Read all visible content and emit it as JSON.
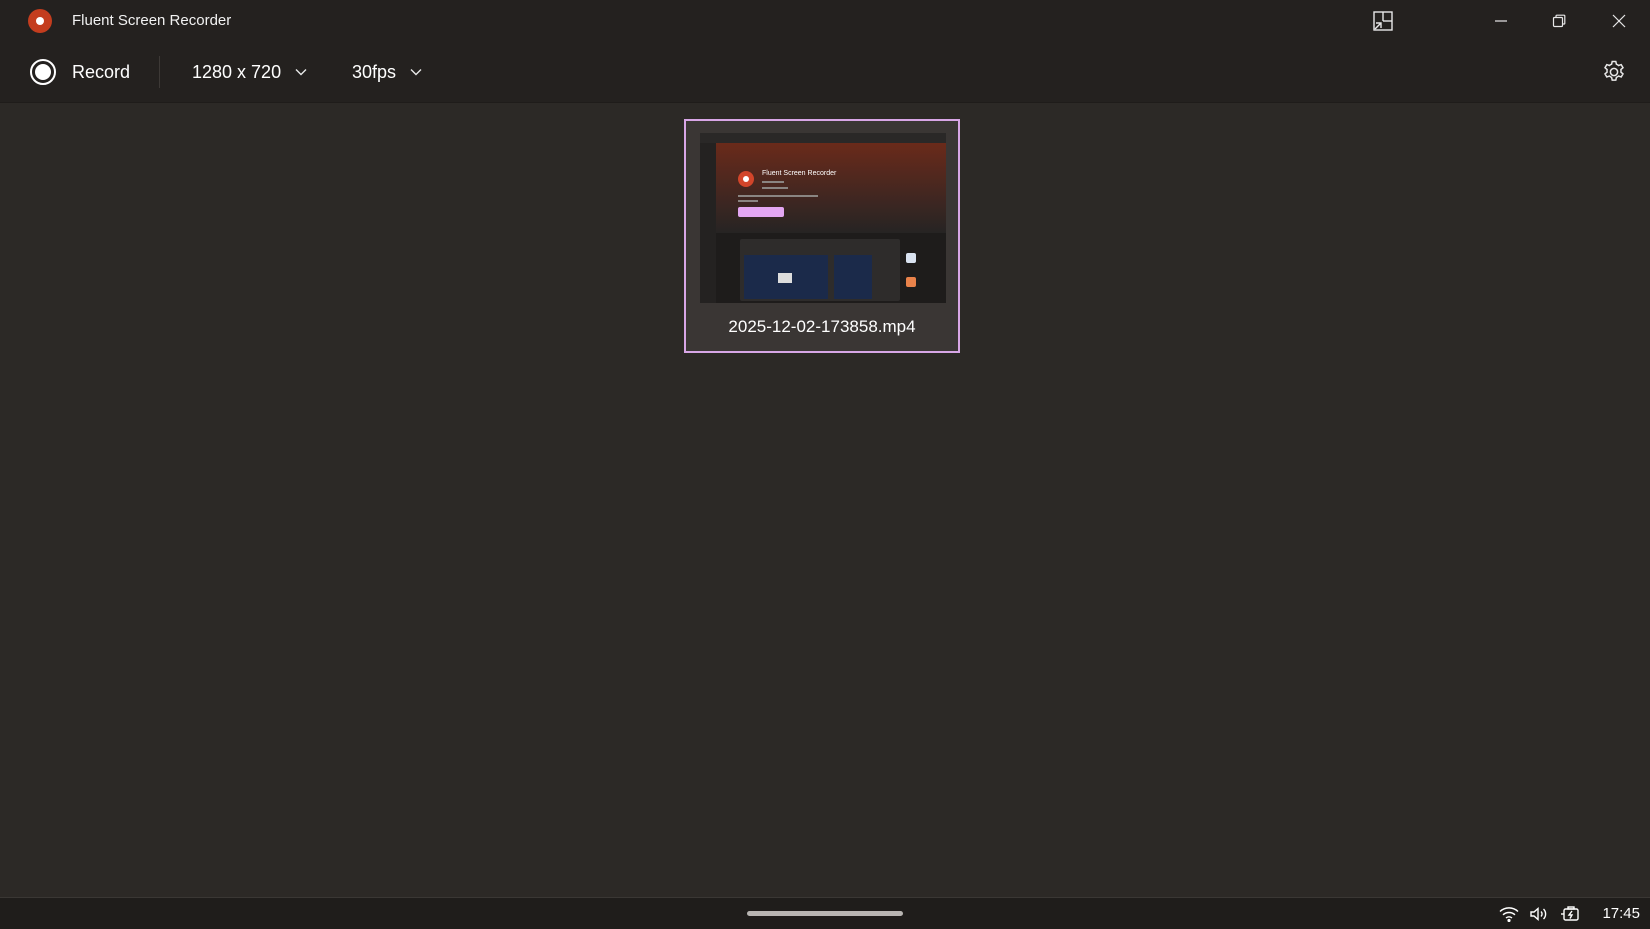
{
  "window": {
    "title": "Fluent Screen Recorder",
    "icons": {
      "app": "record-circle-icon",
      "compact": "compact-overlay-icon",
      "minimize": "minimize-icon",
      "maximize": "restore-icon",
      "close": "close-icon"
    }
  },
  "toolbar": {
    "record_label": "Record",
    "resolution": "1280 x 720",
    "framerate": "30fps",
    "icons": {
      "record": "record-icon",
      "chevron": "chevron-down-icon",
      "settings": "gear-icon"
    }
  },
  "recordings": [
    {
      "filename": "2025-12-02-173858.mp4",
      "thumbnail_title": "Fluent Screen Recorder"
    }
  ],
  "taskbar": {
    "time": "17:45",
    "icons": {
      "wifi": "wifi-icon",
      "volume": "volume-icon",
      "battery": "battery-charging-icon"
    }
  },
  "colors": {
    "accent": "#d8a6e6",
    "app_red": "#c43d1e",
    "background": "#2c2926",
    "titlebar": "#24211f"
  }
}
